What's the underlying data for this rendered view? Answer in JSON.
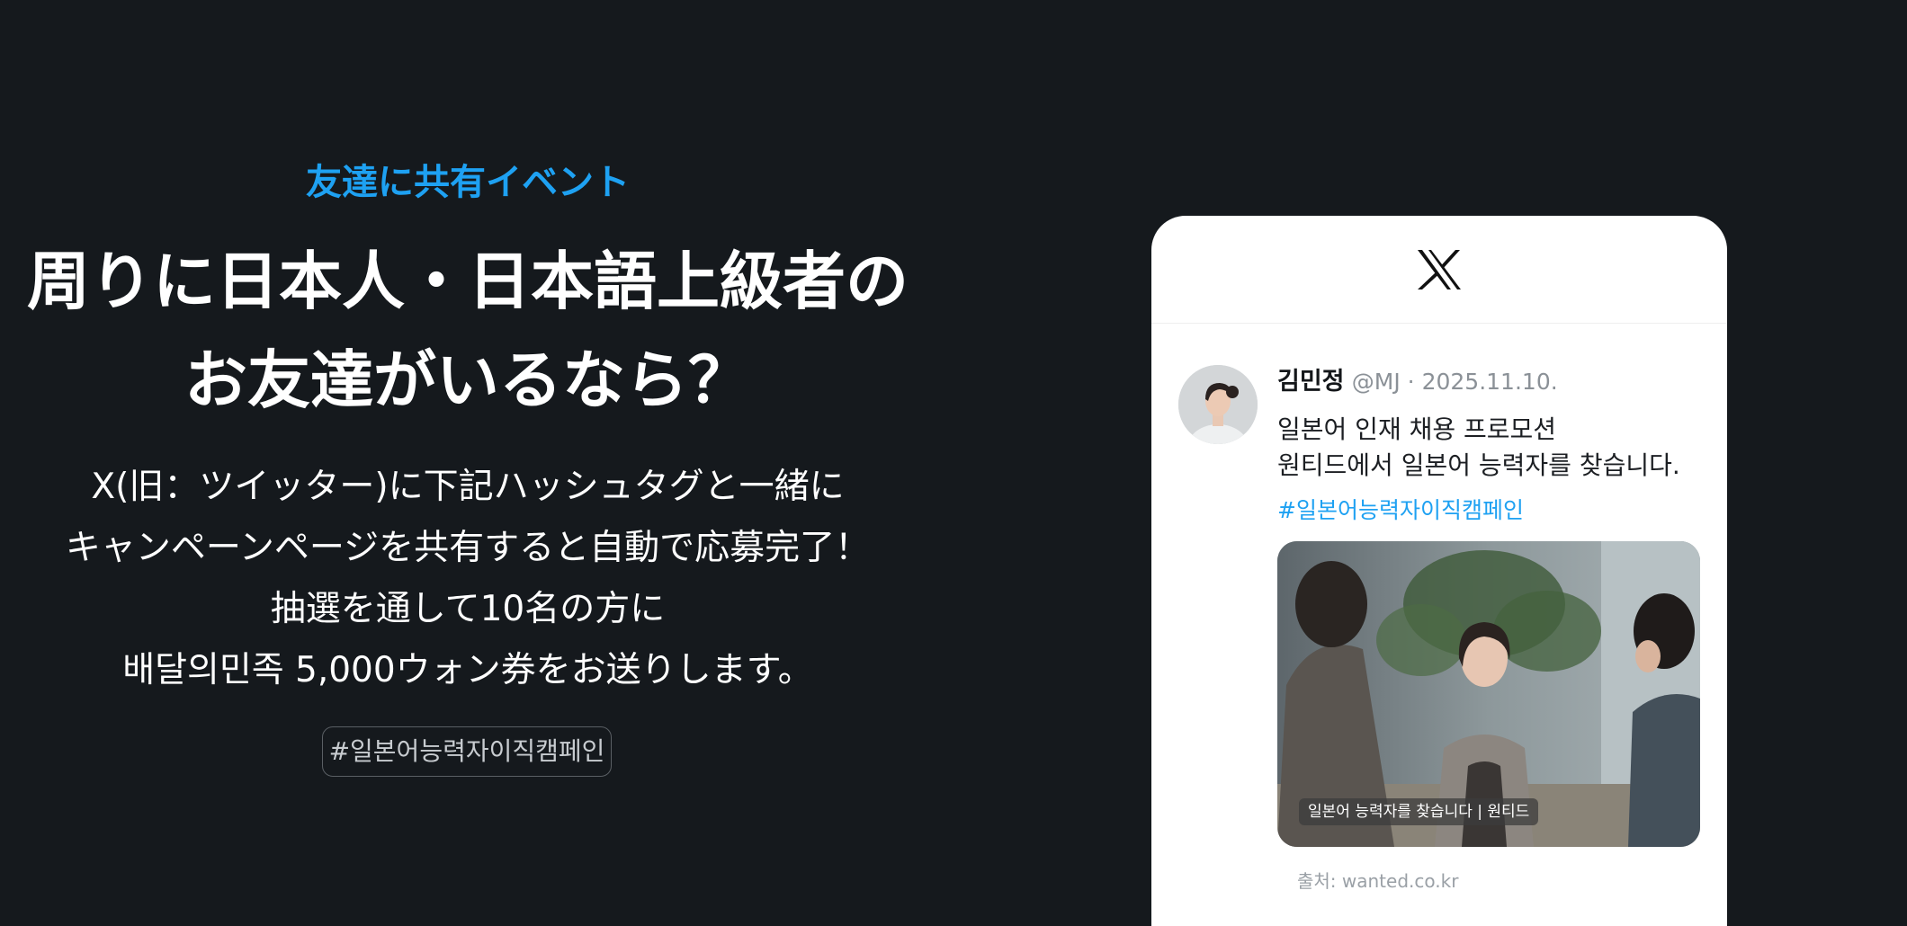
{
  "promo": {
    "eyebrow": "友達に共有イベント",
    "headline_lines": [
      "周りに日本人・日本語上級者の",
      "お友達がいるなら？"
    ],
    "body_lines": [
      "X(旧：ツイッター)に下記ハッシュタグと一緒に",
      "キャンペーンページを共有すると自動で応募完了！",
      "抽選を通して10名の方に",
      "배달의민족 5,000ウォン券をお送りします。"
    ],
    "hashtag": "#일본어능력자이직캠페인"
  },
  "tweet_card": {
    "logo_icon": "x-logo-icon",
    "author_name": "김민정",
    "author_meta": "@MJ · 2025.11.10.",
    "text_lines": [
      "일본어 인재 채용 프로모션",
      "원티드에서 일본어 능력자를 찾습니다."
    ],
    "hashtag": "#일본어능력자이직캠페인",
    "media_caption": "일본어 능력자를 찾습니다 | 원티드",
    "source": "출처: wanted.co.kr"
  },
  "colors": {
    "background": "#15191d",
    "accent": "#1ea1f2",
    "card": "#ffffff"
  }
}
